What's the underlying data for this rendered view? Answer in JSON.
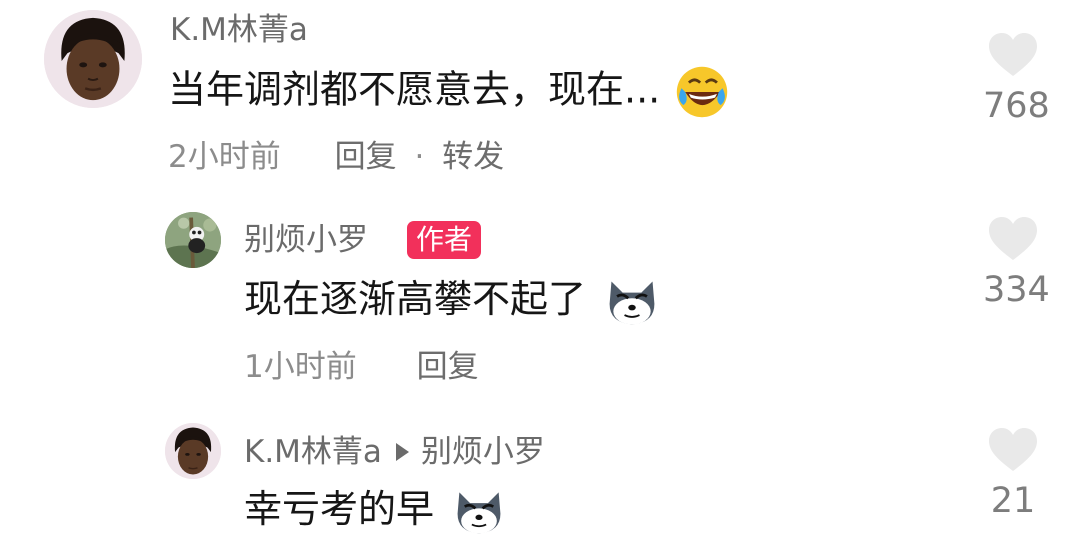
{
  "comments": [
    {
      "author": "K.M林菁a",
      "text": "当年调剂都不愿意去，现在...",
      "emoji": "rolling-laughing-emoji",
      "time": "2小时前",
      "reply_label": "回复",
      "dot": "·",
      "forward_label": "转发",
      "likes": "768"
    },
    {
      "author": "别烦小罗",
      "badge": "作者",
      "text": "现在逐渐高攀不起了",
      "emoji": "doge-emoji",
      "time": "1小时前",
      "reply_label": "回复",
      "likes": "334"
    },
    {
      "author": "K.M林菁a",
      "reply_to": "别烦小罗",
      "text": "幸亏考的早",
      "emoji": "doge-emoji",
      "likes": "21"
    }
  ],
  "colors": {
    "badge": "#f2305b",
    "heart": "#e9e9e9",
    "text": "#161616",
    "secondary": "#6b6b6b"
  }
}
